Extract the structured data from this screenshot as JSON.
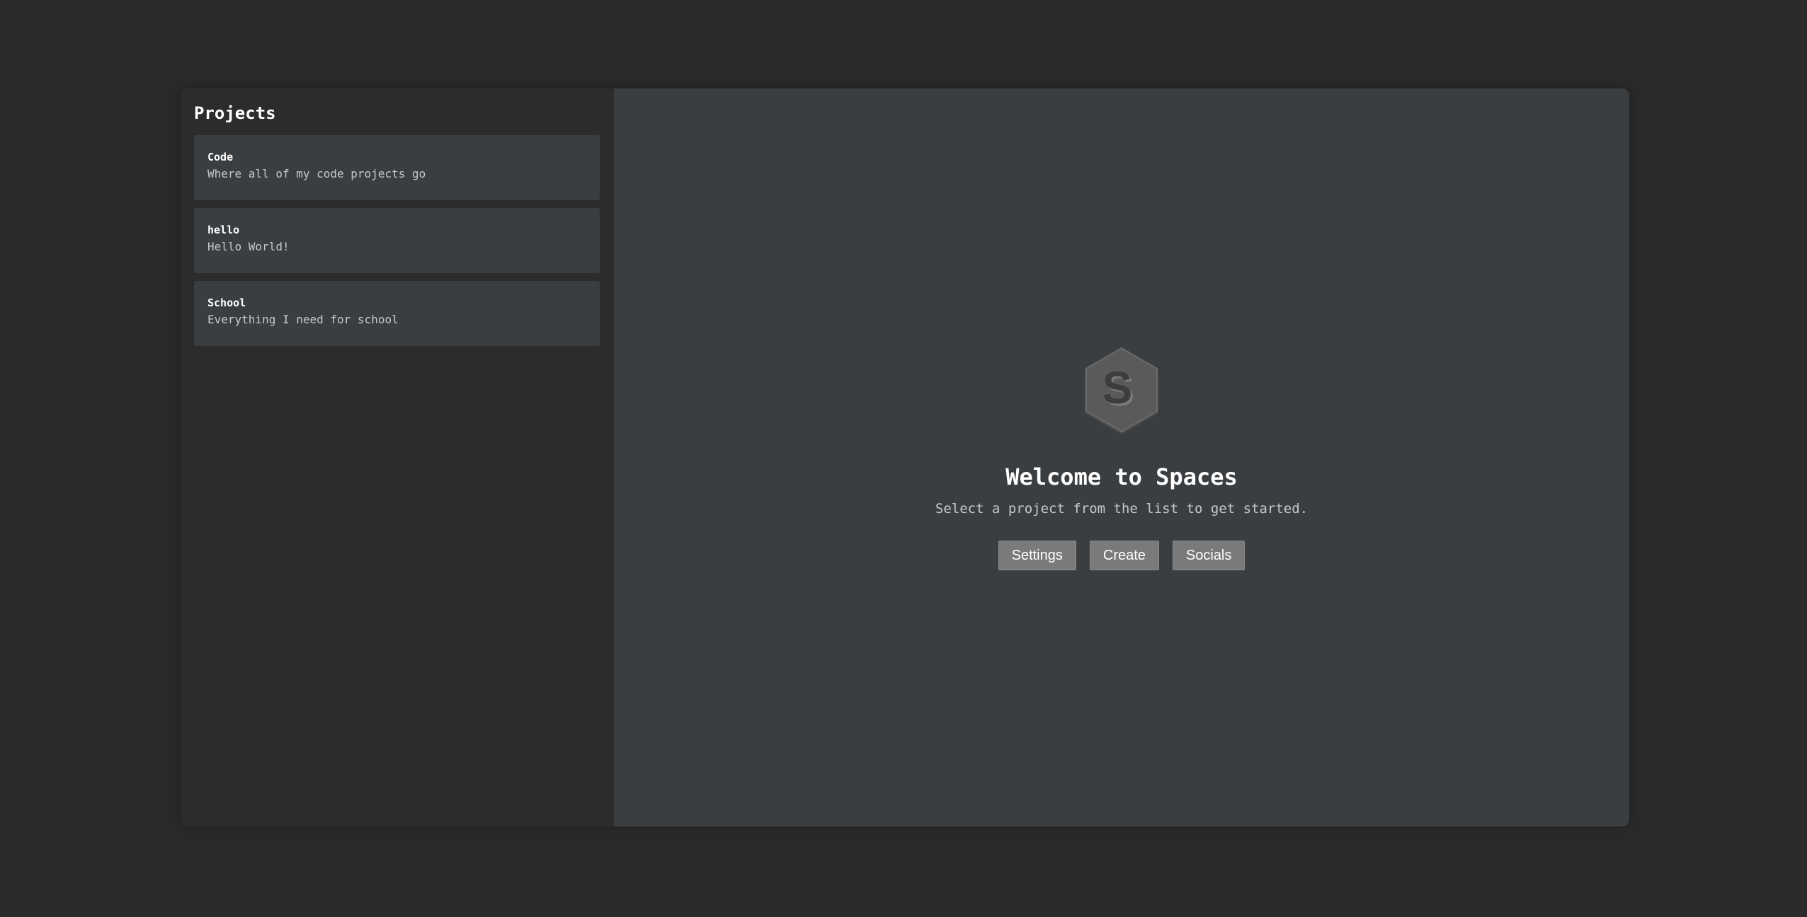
{
  "sidebar": {
    "title": "Projects",
    "projects": [
      {
        "name": "Code",
        "description": "Where all of my code projects go"
      },
      {
        "name": "hello",
        "description": "Hello World!"
      },
      {
        "name": "School",
        "description": "Everything I need for school"
      }
    ]
  },
  "main": {
    "logo": {
      "icon": "spaces-logo-icon",
      "letter": "S"
    },
    "title": "Welcome to Spaces",
    "subtitle": "Select a project from the list to get started.",
    "buttons": {
      "settings": "Settings",
      "create": "Create",
      "socials": "Socials"
    }
  },
  "colors": {
    "page_background": "#2a2a2a",
    "sidebar_background": "#2c2c2c",
    "panel_background": "#3b3e41",
    "card_background": "#3b3e41",
    "button_background": "#7a7a7a",
    "logo_fill": "#5a5a5a"
  }
}
